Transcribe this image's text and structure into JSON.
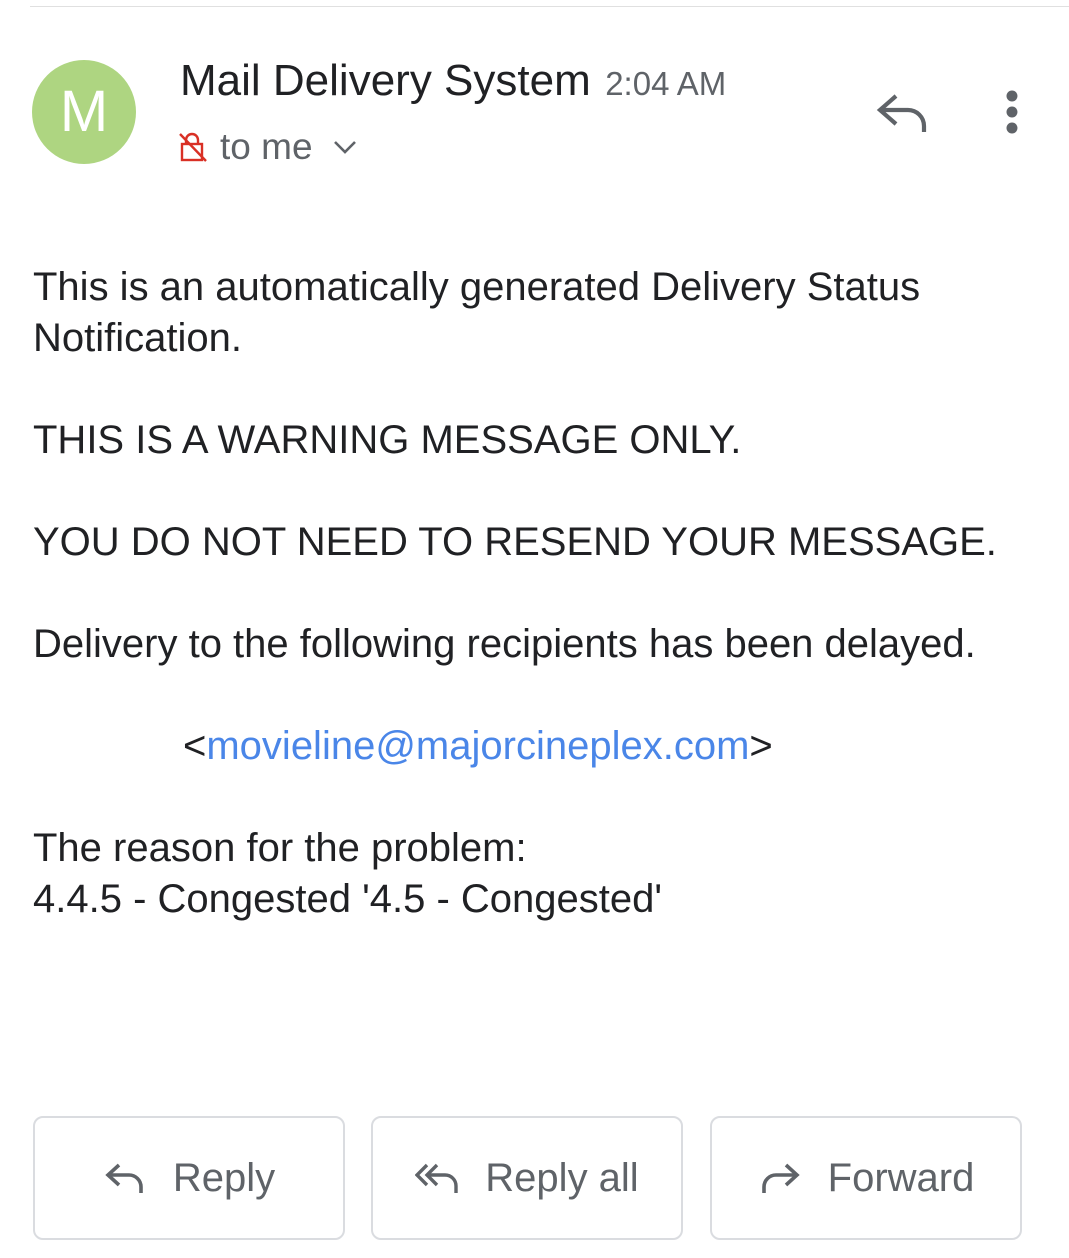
{
  "message": {
    "sender_initial": "M",
    "sender_name": "Mail Delivery System",
    "time": "2:04 AM",
    "recipient_label": "to me",
    "avatar_color": "#aed581",
    "body": {
      "paragraph1": "This is an automatically generated Delivery Status Notification.",
      "paragraph2": "THIS IS A WARNING MESSAGE ONLY.",
      "paragraph3": "YOU DO NOT NEED TO RESEND YOUR MESSAGE.",
      "paragraph4": "Delivery to the following recipients has been delayed.",
      "email_open": "<",
      "email": "movieline@majorcineplex.com",
      "email_close": ">",
      "reason_label": "The reason for the problem:",
      "reason_detail": "4.4.5 - Congested '4.5 - Congested'"
    }
  },
  "header_actions": {
    "reply_icon": "reply-icon",
    "more_icon": "more-vert-icon"
  },
  "actions": {
    "reply_label": "Reply",
    "reply_all_label": "Reply all",
    "forward_label": "Forward"
  },
  "colors": {
    "link": "#4a86e8",
    "unencrypted_lock": "#d93025"
  }
}
